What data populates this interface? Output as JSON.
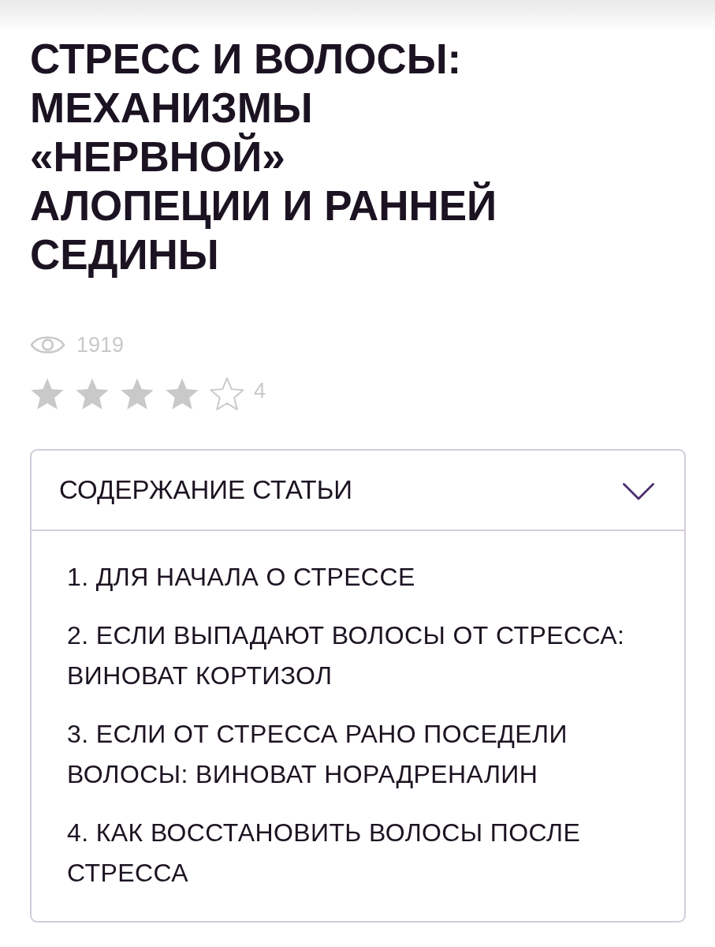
{
  "title": "СТРЕСС И ВОЛОСЫ: МЕХАНИЗМЫ «НЕРВНОЙ» АЛОПЕЦИИ И РАННЕЙ СЕДИНЫ",
  "meta": {
    "views": "1919",
    "rating": {
      "stars": 4,
      "value": "4"
    }
  },
  "toc": {
    "heading": "СОДЕРЖАНИЕ СТАТЬИ",
    "expanded": true,
    "items": [
      "1. ДЛЯ НАЧАЛА О СТРЕССЕ",
      "2. ЕСЛИ ВЫПАДАЮТ ВОЛОСЫ ОТ СТРЕССА: ВИНОВАТ КОРТИЗОЛ",
      "3. ЕСЛИ ОТ СТРЕССА РАНО ПОСЕДЕЛИ ВОЛОСЫ: ВИНОВАТ НОРАДРЕНАЛИН",
      "4. КАК ВОССТАНОВИТЬ ВОЛОСЫ ПОСЛЕ СТРЕССА"
    ]
  }
}
